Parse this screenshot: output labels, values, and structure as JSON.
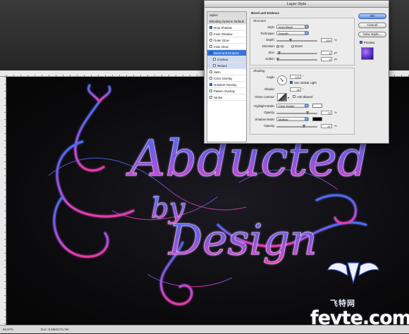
{
  "dialog": {
    "title": "Layer Style",
    "styles_header": "Styles",
    "blending_options": "Blending Options: Default",
    "effects": [
      {
        "label": "Drop Shadow",
        "checked": true
      },
      {
        "label": "Inner Shadow",
        "checked": false
      },
      {
        "label": "Outer Glow",
        "checked": false
      },
      {
        "label": "Inner Glow",
        "checked": false
      },
      {
        "label": "Bevel and Emboss",
        "checked": true,
        "selected": true
      },
      {
        "label": "Contour",
        "checked": false,
        "sub": true
      },
      {
        "label": "Texture",
        "checked": false,
        "sub": true
      },
      {
        "label": "Satin",
        "checked": false
      },
      {
        "label": "Color Overlay",
        "checked": false
      },
      {
        "label": "Gradient Overlay",
        "checked": true
      },
      {
        "label": "Pattern Overlay",
        "checked": false
      },
      {
        "label": "Stroke",
        "checked": false
      }
    ],
    "section_title": "Bevel and Emboss",
    "structure": {
      "title": "Structure",
      "style_label": "Style:",
      "style_value": "Inner Bevel",
      "technique_label": "Technique:",
      "technique_value": "Smooth",
      "depth_label": "Depth:",
      "depth_value": "100",
      "direction_label": "Direction:",
      "direction_up": "Up",
      "direction_down": "Down",
      "size_label": "Size:",
      "size_value": "5",
      "soften_label": "Soften:",
      "soften_value": "0",
      "unit_percent": "%",
      "unit_px": "px"
    },
    "shading": {
      "title": "Shading",
      "angle_label": "Angle:",
      "angle_value": "120",
      "use_global_light": "Use Global Light",
      "altitude_label": "Altitude:",
      "altitude_value": "30",
      "gloss_contour_label": "Gloss Contour:",
      "anti_aliased": "Anti-aliased",
      "highlight_mode_label": "Highlight Mode:",
      "highlight_mode_value": "Color Dodge",
      "highlight_color": "#ffffff",
      "opacity_label": "Opacity:",
      "highlight_opacity": "75",
      "shadow_mode_label": "Shadow Mode:",
      "shadow_mode_value": "Multiply",
      "shadow_color": "#000000",
      "shadow_opacity": "67",
      "unit_percent": "%",
      "unit_deg": "°"
    },
    "buttons": {
      "ok": "OK",
      "cancel": "Cancel",
      "new_style": "New Style...",
      "preview": "Preview"
    }
  },
  "artwork": {
    "line1": "Abducted",
    "line2": "by",
    "line3": "Design"
  },
  "status": {
    "zoom": "66.67%",
    "doc": "Doc: 6.59M/176.7M"
  },
  "watermark": {
    "cn": "飞特网",
    "domain": "fevte.com"
  }
}
